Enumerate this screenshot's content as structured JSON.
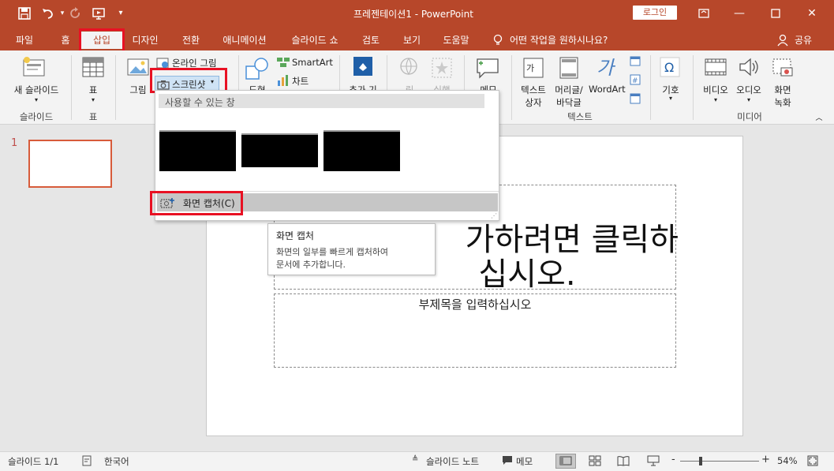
{
  "titlebar": {
    "title": "프레젠테이션1  -  PowerPoint",
    "login_label": "로그인",
    "accent": "#b7472a"
  },
  "tabs": [
    {
      "label": "파일"
    },
    {
      "label": "홈"
    },
    {
      "label": "삽입",
      "active": true
    },
    {
      "label": "디자인"
    },
    {
      "label": "전환"
    },
    {
      "label": "애니메이션"
    },
    {
      "label": "슬라이드 쇼"
    },
    {
      "label": "검토"
    },
    {
      "label": "보기"
    },
    {
      "label": "도움말"
    }
  ],
  "tell_me": "어떤 작업을 원하시나요?",
  "share": "공유",
  "ribbon": {
    "new_slide": "새 슬라이드",
    "slide_group": "슬라이드",
    "table": "표",
    "table_group": "표",
    "picture": "그림",
    "online_picture": "온라인 그림",
    "screenshot": "스크린샷",
    "shapes": "도형",
    "smartart": "SmartArt",
    "chart": "차트",
    "addins": "추가 기",
    "link": "링",
    "action": "실행",
    "comment": "메모",
    "textbox_1": "텍스트",
    "textbox_2": "상자",
    "header_1": "머리글/",
    "header_2": "바닥글",
    "wordart": "WordArt",
    "text_group": "텍스트",
    "symbol": "기호",
    "video": "비디오",
    "audio": "오디오",
    "screenrec_1": "화면",
    "screenrec_2": "녹화",
    "media_group": "미디어"
  },
  "screenshot_menu": {
    "header": "사용할 수 있는 창",
    "screen_clipping": "화면 캡처(C)"
  },
  "tooltip": {
    "title": "화면 캡처",
    "line1": "화면의 일부를 빠르게 캡처하여",
    "line2": "문서에 추가합니다."
  },
  "slide": {
    "number": "1",
    "title_visible_1": "가하려면 클릭하",
    "title_visible_2": "십시오.",
    "subtitle_placeholder": "부제목을 입력하십시오"
  },
  "status": {
    "slide_counter": "슬라이드 1/1",
    "language": "한국어",
    "notes": "슬라이드 노트",
    "comments": "메모",
    "zoom": "54%"
  }
}
